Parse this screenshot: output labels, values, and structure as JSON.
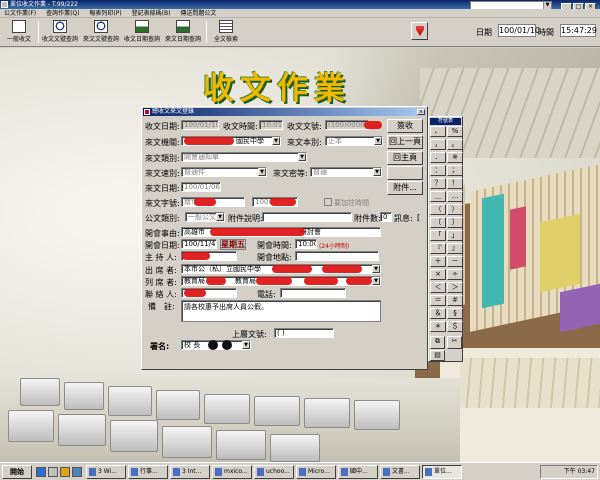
{
  "window": {
    "title": "單位收文作業 - T.99/222"
  },
  "menu": [
    "公文作業(F)",
    "查詢作業(Q)",
    "報表列印(P)",
    "登記表條碼(B)",
    "傳送問題公文"
  ],
  "toolbar": {
    "buttons": [
      {
        "label": "一般收文",
        "icon": "envelope-icon"
      },
      {
        "label": "收文文號查詢",
        "icon": "magnifier-icon"
      },
      {
        "label": "來文文號查詢",
        "icon": "magnifier-icon"
      },
      {
        "label": "收文日期查詢",
        "icon": "calendar-icon"
      },
      {
        "label": "來文日期查詢",
        "icon": "calendar-icon"
      },
      {
        "label": "全文檢索",
        "icon": "document-icon"
      }
    ],
    "date_label": "日期",
    "date_value": "100/01/10",
    "time_label": "時間",
    "time_value": "15:47:29"
  },
  "banner": "收文作業",
  "dialog": {
    "title": "總收文來文登錄",
    "close": "×",
    "receive_date_label": "收文日期:",
    "receive_date": "100/01/10",
    "receive_time_label": "收文時間:",
    "receive_time": "10:01",
    "receive_no_label": "收文文號:",
    "receive_no": "(100)0000",
    "save_button": "簽收",
    "from_org_label": "來文機關:",
    "from_org": "國民中學",
    "doc_copy_label": "來文本別:",
    "doc_copy": "正本",
    "prev_page_button": "回上一頁",
    "doc_class_label": "來文類別:",
    "doc_class": "開會通知單",
    "main_page_button": "回主頁",
    "speed_label": "來文速別:",
    "speed": "普通件",
    "secrecy_label": "來文密等:",
    "secrecy": "普通",
    "doc_date_label": "來文日期:",
    "doc_date": "100/01/06",
    "attach_button": "附件...",
    "doc_no_label": "來文字號:",
    "doc_no_prefix": "南市",
    "doc_no_value": "10000",
    "note_check": "要加註時間",
    "doc_type_label": "公文類別:",
    "doc_type": "一般公文",
    "attach_desc_label": "附件說明:",
    "attach_count_label": "附件數:",
    "attach_count": "0",
    "message_label": "訊息:",
    "message_value": "[",
    "meeting_reason_label": "開會事由:",
    "meeting_reason": "高雄市",
    "meeting_reason_tail": "研討會",
    "meeting_date_label": "開會日期:",
    "meeting_date": "100/11/4",
    "weekday": "星期五",
    "meeting_time_label": "開會時間:",
    "meeting_time": "10:00",
    "meeting_time_note": "(24小時制)",
    "chair_label": "主 持 人:",
    "place_label": "開會地點:",
    "attendee_label": "出 席 者:",
    "attendee_value": "本市公（私）立國民中學",
    "cc_label": "列 席 者:",
    "cc_value_1": "教育局",
    "cc_value_2": "教育局",
    "contact_label": "聯 絡 人:",
    "phone_label": "電話:",
    "memo_label": "備　註:",
    "memo_value": "請各校惠予出席人員公假。",
    "upper_no_label": "上層文號:",
    "upper_no_value": "(   )",
    "sign_label": "署名:",
    "sign_value": "校 長"
  },
  "keypad": {
    "title": "符號表",
    "keys": [
      "、",
      "%",
      "，",
      "。",
      "．",
      "※",
      "：",
      "；",
      "？",
      "！",
      "＿",
      "…",
      "（",
      "）",
      "〔",
      "〕",
      "「",
      "」",
      "『",
      "』",
      "＋",
      "－",
      "×",
      "÷",
      "＜",
      "＞",
      "＝",
      "＃",
      "＆",
      "§",
      "＊",
      "＄"
    ]
  },
  "taskbar": {
    "start": "開始",
    "tasks": [
      "3 Wi...",
      "行事...",
      "3 Int...",
      "mxico...",
      "uchoo...",
      "Micro...",
      "國中...",
      "文書...",
      "單位..."
    ],
    "clock": "下午 03:47"
  },
  "colors": {
    "accent": "#0a246a",
    "redact": "#e01010",
    "banner": "#f0b800"
  }
}
